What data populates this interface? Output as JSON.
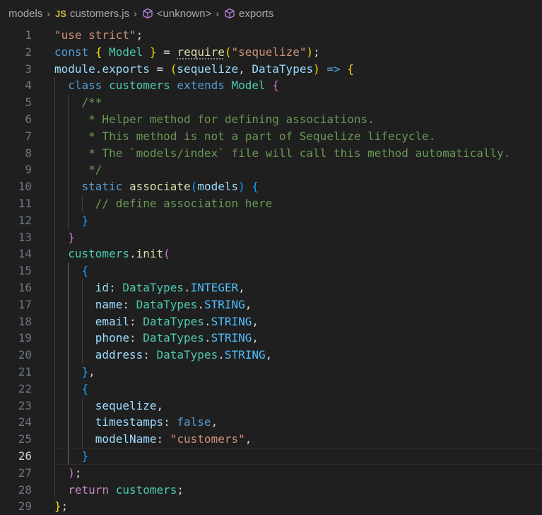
{
  "breadcrumb": {
    "folder": "models",
    "file_icon": "JS",
    "file": "customers.js",
    "symbol1": "<unknown>",
    "symbol2": "exports"
  },
  "editor": {
    "active_line": 26,
    "lines": [
      {
        "n": 1,
        "indent": 0,
        "tokens": [
          [
            "s",
            "\"use strict\""
          ],
          [
            "p",
            ";"
          ]
        ]
      },
      {
        "n": 2,
        "indent": 0,
        "tokens": [
          [
            "k",
            "const"
          ],
          [
            "p",
            " "
          ],
          [
            "b1",
            "{"
          ],
          [
            "p",
            " "
          ],
          [
            "t",
            "Model"
          ],
          [
            "p",
            " "
          ],
          [
            "b1",
            "}"
          ],
          [
            "p",
            " = "
          ],
          [
            "f",
            "require",
            "squig"
          ],
          [
            "b1",
            "("
          ],
          [
            "s",
            "\"sequelize\""
          ],
          [
            "b1",
            ")"
          ],
          [
            "p",
            ";"
          ]
        ]
      },
      {
        "n": 3,
        "indent": 0,
        "tokens": [
          [
            "v",
            "module"
          ],
          [
            "p",
            "."
          ],
          [
            "v",
            "exports"
          ],
          [
            "p",
            " = "
          ],
          [
            "b1",
            "("
          ],
          [
            "v",
            "sequelize"
          ],
          [
            "p",
            ", "
          ],
          [
            "v",
            "DataTypes"
          ],
          [
            "b1",
            ")"
          ],
          [
            "p",
            " "
          ],
          [
            "k",
            "=>"
          ],
          [
            "p",
            " "
          ],
          [
            "b1",
            "{"
          ]
        ]
      },
      {
        "n": 4,
        "indent": 1,
        "tokens": [
          [
            "k",
            "class"
          ],
          [
            "p",
            " "
          ],
          [
            "t",
            "customers"
          ],
          [
            "p",
            " "
          ],
          [
            "k",
            "extends"
          ],
          [
            "p",
            " "
          ],
          [
            "t",
            "Model"
          ],
          [
            "p",
            " "
          ],
          [
            "b2",
            "{"
          ]
        ]
      },
      {
        "n": 5,
        "indent": 2,
        "tokens": [
          [
            "c",
            "/**"
          ]
        ]
      },
      {
        "n": 6,
        "indent": 2,
        "tokens": [
          [
            "c",
            " * Helper method for defining associations."
          ]
        ]
      },
      {
        "n": 7,
        "indent": 2,
        "tokens": [
          [
            "c",
            " * This method is not a part of Sequelize lifecycle."
          ]
        ]
      },
      {
        "n": 8,
        "indent": 2,
        "tokens": [
          [
            "c",
            " * The `models/index` file will call this method automatically."
          ]
        ]
      },
      {
        "n": 9,
        "indent": 2,
        "tokens": [
          [
            "c",
            " */"
          ]
        ]
      },
      {
        "n": 10,
        "indent": 2,
        "tokens": [
          [
            "k",
            "static"
          ],
          [
            "p",
            " "
          ],
          [
            "f",
            "associate"
          ],
          [
            "b3",
            "("
          ],
          [
            "v",
            "models"
          ],
          [
            "b3",
            ")"
          ],
          [
            "p",
            " "
          ],
          [
            "b3",
            "{"
          ]
        ]
      },
      {
        "n": 11,
        "indent": 3,
        "tokens": [
          [
            "c",
            "// define association here"
          ]
        ]
      },
      {
        "n": 12,
        "indent": 2,
        "tokens": [
          [
            "b3",
            "}"
          ]
        ]
      },
      {
        "n": 13,
        "indent": 1,
        "tokens": [
          [
            "b2",
            "}"
          ]
        ]
      },
      {
        "n": 14,
        "indent": 1,
        "tokens": [
          [
            "t",
            "customers"
          ],
          [
            "p",
            "."
          ],
          [
            "f",
            "init"
          ],
          [
            "b2",
            "("
          ]
        ]
      },
      {
        "n": 15,
        "indent": 2,
        "tokens": [
          [
            "b3",
            "{"
          ]
        ]
      },
      {
        "n": 16,
        "indent": 3,
        "tokens": [
          [
            "v",
            "id"
          ],
          [
            "p",
            ": "
          ],
          [
            "t",
            "DataTypes"
          ],
          [
            "p",
            "."
          ],
          [
            "cn",
            "INTEGER"
          ],
          [
            "p",
            ","
          ]
        ]
      },
      {
        "n": 17,
        "indent": 3,
        "tokens": [
          [
            "v",
            "name"
          ],
          [
            "p",
            ": "
          ],
          [
            "t",
            "DataTypes"
          ],
          [
            "p",
            "."
          ],
          [
            "cn",
            "STRING"
          ],
          [
            "p",
            ","
          ]
        ]
      },
      {
        "n": 18,
        "indent": 3,
        "tokens": [
          [
            "v",
            "email"
          ],
          [
            "p",
            ": "
          ],
          [
            "t",
            "DataTypes"
          ],
          [
            "p",
            "."
          ],
          [
            "cn",
            "STRING"
          ],
          [
            "p",
            ","
          ]
        ]
      },
      {
        "n": 19,
        "indent": 3,
        "tokens": [
          [
            "v",
            "phone"
          ],
          [
            "p",
            ": "
          ],
          [
            "t",
            "DataTypes"
          ],
          [
            "p",
            "."
          ],
          [
            "cn",
            "STRING"
          ],
          [
            "p",
            ","
          ]
        ]
      },
      {
        "n": 20,
        "indent": 3,
        "tokens": [
          [
            "v",
            "address"
          ],
          [
            "p",
            ": "
          ],
          [
            "t",
            "DataTypes"
          ],
          [
            "p",
            "."
          ],
          [
            "cn",
            "STRING"
          ],
          [
            "p",
            ","
          ]
        ]
      },
      {
        "n": 21,
        "indent": 2,
        "tokens": [
          [
            "b3",
            "}"
          ],
          [
            "p",
            ","
          ]
        ]
      },
      {
        "n": 22,
        "indent": 2,
        "tokens": [
          [
            "b3",
            "{"
          ]
        ]
      },
      {
        "n": 23,
        "indent": 3,
        "tokens": [
          [
            "v",
            "sequelize"
          ],
          [
            "p",
            ","
          ]
        ]
      },
      {
        "n": 24,
        "indent": 3,
        "tokens": [
          [
            "v",
            "timestamps"
          ],
          [
            "p",
            ": "
          ],
          [
            "k",
            "false"
          ],
          [
            "p",
            ","
          ]
        ]
      },
      {
        "n": 25,
        "indent": 3,
        "tokens": [
          [
            "v",
            "modelName"
          ],
          [
            "p",
            ": "
          ],
          [
            "s",
            "\"customers\""
          ],
          [
            "p",
            ","
          ]
        ]
      },
      {
        "n": 26,
        "indent": 2,
        "tokens": [
          [
            "b3",
            "}"
          ]
        ]
      },
      {
        "n": 27,
        "indent": 1,
        "tokens": [
          [
            "b2",
            ")"
          ],
          [
            "p",
            ";"
          ]
        ]
      },
      {
        "n": 28,
        "indent": 1,
        "tokens": [
          [
            "kw",
            "return"
          ],
          [
            "p",
            " "
          ],
          [
            "t",
            "customers"
          ],
          [
            "p",
            ";"
          ]
        ]
      },
      {
        "n": 29,
        "indent": 0,
        "tokens": [
          [
            "b1",
            "}"
          ],
          [
            "p",
            ";"
          ]
        ]
      }
    ]
  }
}
